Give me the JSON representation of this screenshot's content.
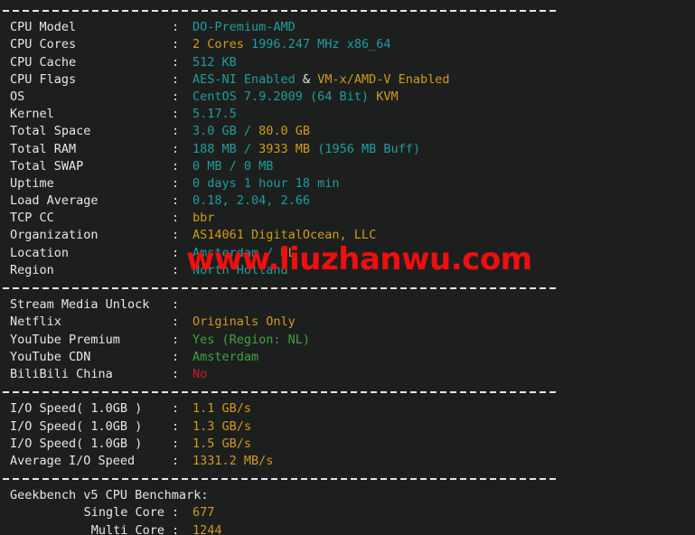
{
  "terminal": {
    "background": "#1d1f1e",
    "colors": {
      "label": "#e8e6e3",
      "teal": "#1f9e9e",
      "orange": "#cf9b1b",
      "green": "#42a142",
      "red": "#c4201d",
      "watermark": "#ee0f0f"
    },
    "colon": ":"
  },
  "watermark": {
    "text": "www.liuzhanwu.com"
  },
  "section_system": {
    "rows": [
      {
        "label": "CPU Model",
        "parts": [
          {
            "text": "DO-Premium-AMD",
            "color": "teal"
          }
        ]
      },
      {
        "label": "CPU Cores",
        "parts": [
          {
            "text": "2 Cores ",
            "color": "orange"
          },
          {
            "text": "1996.247 MHz x86_64",
            "color": "teal"
          }
        ]
      },
      {
        "label": "CPU Cache",
        "parts": [
          {
            "text": "512 KB",
            "color": "teal"
          }
        ]
      },
      {
        "label": "CPU Flags",
        "parts": [
          {
            "text": "AES-NI Enabled",
            "color": "teal"
          },
          {
            "text": " & ",
            "color": "label"
          },
          {
            "text": "VM-x/AMD-V Enabled",
            "color": "orange"
          }
        ]
      },
      {
        "label": "OS",
        "parts": [
          {
            "text": "CentOS 7.9.2009 (64 Bit) ",
            "color": "teal"
          },
          {
            "text": "KVM",
            "color": "orange"
          }
        ]
      },
      {
        "label": "Kernel",
        "parts": [
          {
            "text": "5.17.5",
            "color": "teal"
          }
        ]
      },
      {
        "label": "Total Space",
        "parts": [
          {
            "text": "3.0 GB / ",
            "color": "teal"
          },
          {
            "text": "80.0 GB",
            "color": "orange"
          }
        ]
      },
      {
        "label": "Total RAM",
        "parts": [
          {
            "text": "188 MB / ",
            "color": "teal"
          },
          {
            "text": "3933 MB",
            "color": "orange"
          },
          {
            "text": " (1956 MB Buff)",
            "color": "teal"
          }
        ]
      },
      {
        "label": "Total SWAP",
        "parts": [
          {
            "text": "0 MB / 0 MB",
            "color": "teal"
          }
        ]
      },
      {
        "label": "Uptime",
        "parts": [
          {
            "text": "0 days 1 hour 18 min",
            "color": "teal"
          }
        ]
      },
      {
        "label": "Load Average",
        "parts": [
          {
            "text": "0.18, 2.04, 2.66",
            "color": "teal"
          }
        ]
      },
      {
        "label": "TCP CC",
        "parts": [
          {
            "text": "bbr",
            "color": "orange"
          }
        ]
      },
      {
        "label": "Organization",
        "parts": [
          {
            "text": "AS14061 DigitalOcean, LLC",
            "color": "orange"
          }
        ]
      },
      {
        "label": "Location",
        "parts": [
          {
            "text": "Amsterdam / ",
            "color": "teal"
          },
          {
            "text": "NL",
            "color": "orange"
          }
        ]
      },
      {
        "label": "Region",
        "parts": [
          {
            "text": "North Holland",
            "color": "teal"
          }
        ]
      }
    ]
  },
  "section_stream": {
    "rows": [
      {
        "label": "Stream Media Unlock",
        "parts": []
      },
      {
        "label": "Netflix",
        "parts": [
          {
            "text": "Originals Only",
            "color": "orange"
          }
        ]
      },
      {
        "label": "YouTube Premium",
        "parts": [
          {
            "text": "Yes (Region: NL)",
            "color": "green"
          }
        ]
      },
      {
        "label": "YouTube CDN",
        "parts": [
          {
            "text": "Amsterdam",
            "color": "green"
          }
        ]
      },
      {
        "label": "BiliBili China",
        "parts": [
          {
            "text": "No",
            "color": "red"
          }
        ]
      }
    ]
  },
  "section_io": {
    "rows": [
      {
        "label": "I/O Speed( 1.0GB )",
        "parts": [
          {
            "text": "1.1 GB/s",
            "color": "orange"
          }
        ]
      },
      {
        "label": "I/O Speed( 1.0GB )",
        "parts": [
          {
            "text": "1.3 GB/s",
            "color": "orange"
          }
        ]
      },
      {
        "label": "I/O Speed( 1.0GB )",
        "parts": [
          {
            "text": "1.5 GB/s",
            "color": "orange"
          }
        ]
      },
      {
        "label": "Average I/O Speed",
        "parts": [
          {
            "text": "1331.2 MB/s",
            "color": "orange"
          }
        ]
      }
    ]
  },
  "section_geekbench": {
    "heading": "Geekbench v5 CPU Benchmark:",
    "rows": [
      {
        "label": "Single Core",
        "indent": true,
        "parts": [
          {
            "text": "677",
            "color": "orange"
          }
        ]
      },
      {
        "label": "Multi Core",
        "indent": true,
        "parts": [
          {
            "text": "1244",
            "color": "orange"
          }
        ]
      }
    ]
  }
}
